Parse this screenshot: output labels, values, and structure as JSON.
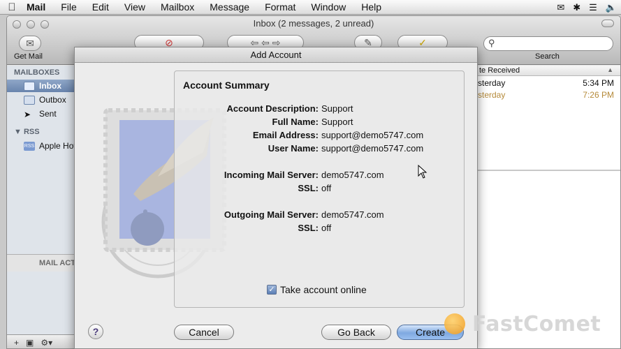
{
  "menubar": {
    "app": "Mail",
    "items": [
      "File",
      "Edit",
      "View",
      "Mailbox",
      "Message",
      "Format",
      "Window",
      "Help"
    ]
  },
  "window": {
    "title": "Inbox (2 messages, 2 unread)",
    "toolbar": {
      "get_mail_label": "Get Mail",
      "search_label": "Search"
    }
  },
  "sidebar": {
    "heading": "MAILBOXES",
    "items": [
      {
        "label": "Inbox",
        "icon": "inbox-icon"
      },
      {
        "label": "Outbox",
        "icon": "outbox-icon"
      },
      {
        "label": "Sent",
        "icon": "sent-icon"
      }
    ],
    "rss_heading": "RSS",
    "rss_items": [
      {
        "label": "Apple Hot",
        "icon": "rss-icon"
      }
    ],
    "mail_activity": "MAIL ACT"
  },
  "message_list": {
    "column": "te Received",
    "rows": [
      {
        "date": "sterday",
        "time": "5:34 PM",
        "unread": false
      },
      {
        "date": "sterday",
        "time": "7:26 PM",
        "unread": true
      }
    ]
  },
  "sheet": {
    "title": "Add Account",
    "summary_title": "Account Summary",
    "fields": [
      {
        "key": "Account Description:",
        "value": "Support"
      },
      {
        "key": "Full Name:",
        "value": "Support"
      },
      {
        "key": "Email Address:",
        "value": "support@demo5747.com"
      },
      {
        "key": "User Name:",
        "value": "support@demo5747.com"
      },
      {
        "key": "Incoming Mail Server:",
        "value": "demo5747.com"
      },
      {
        "key": "SSL:",
        "value": "off"
      },
      {
        "key": "Outgoing Mail Server:",
        "value": "demo5747.com"
      },
      {
        "key": "SSL:",
        "value": "off"
      }
    ],
    "checkbox_label": "Take account online",
    "checkbox_checked": true,
    "help": "?",
    "buttons": {
      "cancel": "Cancel",
      "go_back": "Go Back",
      "create": "Create"
    }
  },
  "watermark": {
    "brand": "FastComet",
    "accent": "#f19a1d"
  },
  "colors": {
    "selection": "#6984ad",
    "unread": "#b58a3a"
  }
}
